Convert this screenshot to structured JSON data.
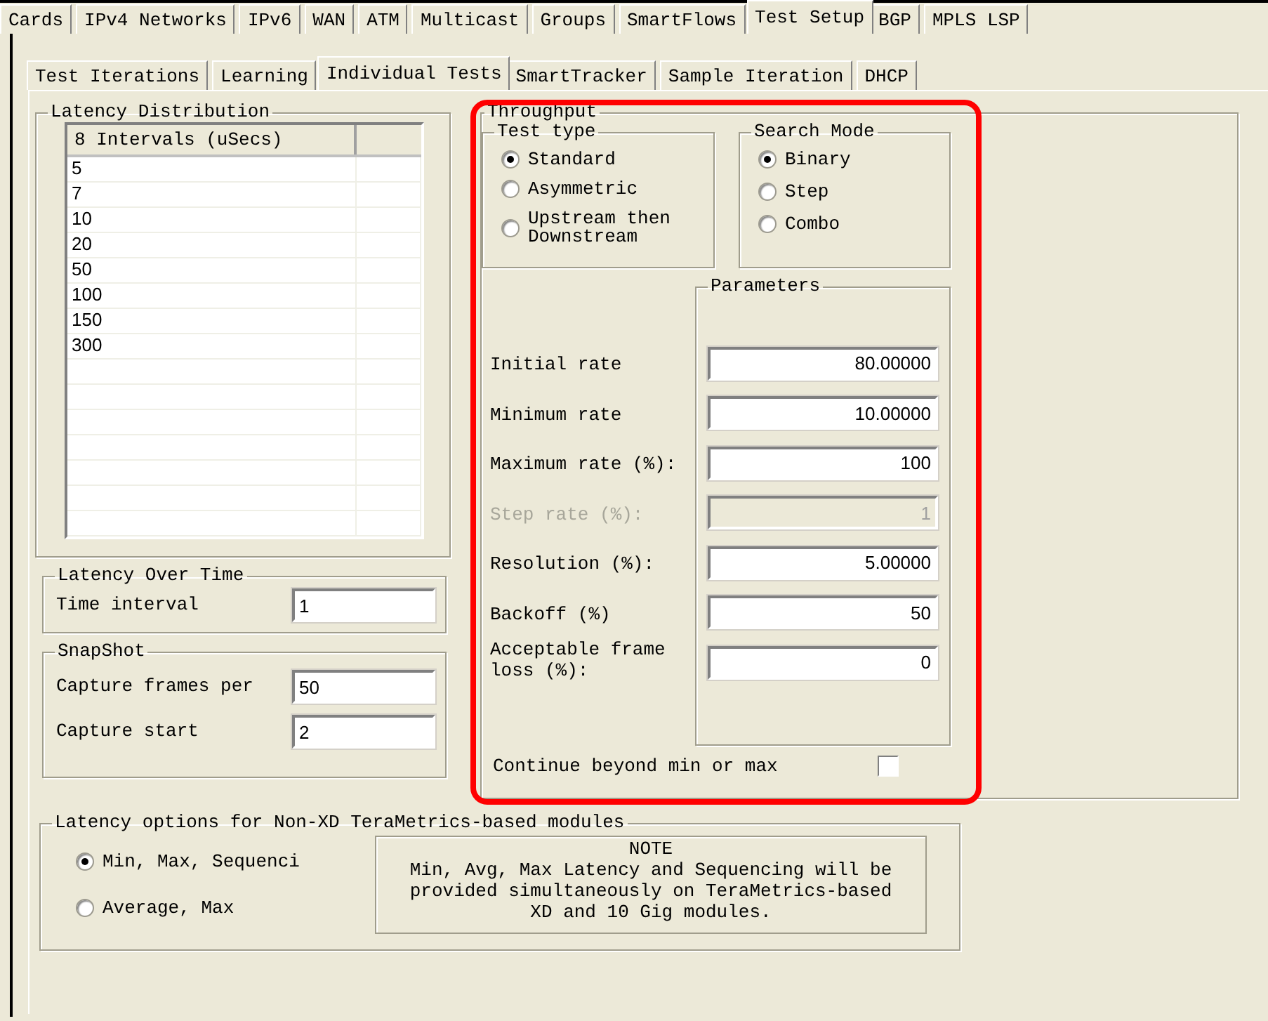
{
  "top_tabs": [
    {
      "label": "Cards",
      "selected": false
    },
    {
      "label": "IPv4 Networks",
      "selected": false
    },
    {
      "label": "IPv6",
      "selected": false
    },
    {
      "label": "WAN",
      "selected": false
    },
    {
      "label": "ATM",
      "selected": false
    },
    {
      "label": "Multicast",
      "selected": false
    },
    {
      "label": "Groups",
      "selected": false
    },
    {
      "label": "SmartFlows",
      "selected": false
    },
    {
      "label": "Test Setup",
      "selected": true
    },
    {
      "label": "BGP",
      "selected": false
    },
    {
      "label": "MPLS LSP",
      "selected": false
    }
  ],
  "sub_tabs": [
    {
      "label": "Test Iterations",
      "selected": false
    },
    {
      "label": "Learning",
      "selected": false
    },
    {
      "label": "Individual Tests",
      "selected": true
    },
    {
      "label": "SmartTracker",
      "selected": false
    },
    {
      "label": "Sample Iteration",
      "selected": false
    },
    {
      "label": "DHCP",
      "selected": false
    }
  ],
  "latency_distribution": {
    "title": "Latency Distribution",
    "column_1": "8 Intervals (uSecs)",
    "rows": [
      "5",
      "7",
      "10",
      "20",
      "50",
      "100",
      "150",
      "300"
    ]
  },
  "latency_over_time": {
    "title": "Latency Over Time",
    "fields": [
      {
        "label": "Time interval",
        "value": "1"
      }
    ]
  },
  "snapshot": {
    "title": "SnapShot",
    "fields": [
      {
        "label": "Capture frames per",
        "value": "50"
      },
      {
        "label": "Capture start",
        "value": "2"
      }
    ]
  },
  "throughput": {
    "title": "Throughput",
    "highlighted": true,
    "test_type": {
      "title": "Test type",
      "options": [
        {
          "label": "Standard",
          "selected": true
        },
        {
          "label": "Asymmetric",
          "selected": false
        },
        {
          "label": "Upstream then Downstream",
          "selected": false
        }
      ]
    },
    "search_mode": {
      "title": "Search Mode",
      "options": [
        {
          "label": "Binary",
          "selected": true
        },
        {
          "label": "Step",
          "selected": false
        },
        {
          "label": "Combo",
          "selected": false
        }
      ]
    },
    "parameters": {
      "title": "Parameters",
      "fields": [
        {
          "label": "Initial rate",
          "value": "80.00000",
          "disabled": false
        },
        {
          "label": "Minimum rate",
          "value": "10.00000",
          "disabled": false
        },
        {
          "label": "Maximum rate (%):",
          "value": "100",
          "disabled": false
        },
        {
          "label": "Step rate (%):",
          "value": "1",
          "disabled": true
        },
        {
          "label": "Resolution (%):",
          "value": "5.00000",
          "disabled": false
        },
        {
          "label": "Backoff (%)",
          "value": "50",
          "disabled": false
        },
        {
          "label": "Acceptable frame loss (%):",
          "value": "0",
          "disabled": false
        }
      ]
    },
    "continue_beyond": {
      "label": "Continue beyond min or max",
      "checked": false
    }
  },
  "latency_options": {
    "title": "Latency options for Non-XD TeraMetrics-based modules",
    "options": [
      {
        "label": "Min, Max, Sequenci",
        "selected": true
      },
      {
        "label": "Average, Max",
        "selected": false
      }
    ],
    "note": {
      "title": "NOTE",
      "text": "Min, Avg, Max Latency and Sequencing will be provided simultaneously on TeraMetrics-based XD and 10 Gig modules."
    }
  }
}
